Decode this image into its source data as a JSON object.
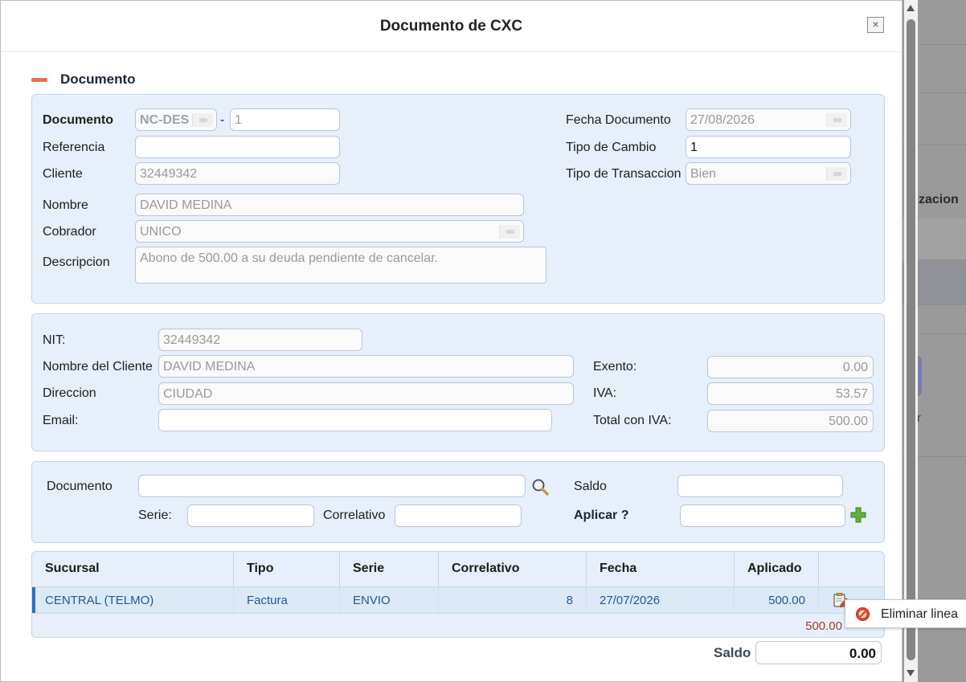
{
  "background": {
    "partial_label": "zacion",
    "partial_label2": "r"
  },
  "modal": {
    "title": "Documento de CXC",
    "close_glyph": "×"
  },
  "section": {
    "title": "Documento"
  },
  "documento": {
    "documento_label": "Documento",
    "doc_code": "NC-DES",
    "separator": "-",
    "doc_number": "1",
    "referencia_label": "Referencia",
    "referencia_value": "",
    "cliente_label": "Cliente",
    "cliente_value": "32449342",
    "nombre_label": "Nombre",
    "nombre_value": "DAVID MEDINA",
    "cobrador_label": "Cobrador",
    "cobrador_value": "UNICO",
    "descripcion_label": "Descripcion",
    "descripcion_value": "Abono de 500.00 a su deuda pendiente de cancelar.",
    "fecha_label": "Fecha Documento",
    "fecha_value": "27/08/2026",
    "tipo_cambio_label": "Tipo de Cambio",
    "tipo_cambio_value": "1",
    "tipo_trans_label": "Tipo de Transaccion",
    "tipo_trans_value": "Bien"
  },
  "cliente_info": {
    "nit_label": "NIT:",
    "nit_value": "32449342",
    "nombre_label": "Nombre del Cliente",
    "nombre_value": "DAVID MEDINA",
    "direccion_label": "Direccion",
    "direccion_value": "CIUDAD",
    "email_label": "Email:",
    "email_value": "",
    "exento_label": "Exento:",
    "exento_value": "0.00",
    "iva_label": "IVA:",
    "iva_value": "53.57",
    "total_label": "Total con IVA:",
    "total_value": "500.00"
  },
  "aplicar": {
    "documento_label": "Documento",
    "saldo_label": "Saldo",
    "serie_label": "Serie:",
    "correlativo_label": "Correlativo",
    "aplicar_label": "Aplicar ?"
  },
  "grid": {
    "headers": [
      "Sucursal",
      "Tipo",
      "Serie",
      "Correlativo",
      "Fecha",
      "Aplicado"
    ],
    "rows": [
      {
        "sucursal": "CENTRAL (TELMO)",
        "tipo": "Factura",
        "serie": "ENVIO",
        "correlativo": "8",
        "fecha": "27/07/2026",
        "aplicado": "500.00"
      }
    ],
    "total_aplicado": "500.00"
  },
  "tooltip": {
    "label": "Eliminar linea"
  },
  "footer": {
    "saldo_label": "Saldo",
    "saldo_value": "0.00"
  },
  "colors": {
    "panel_bg": "#e7f0fa",
    "accent": "#2f6fc0",
    "link_text": "#1f5a96",
    "total_red": "#a33a2a",
    "minus": "#e5724f"
  }
}
